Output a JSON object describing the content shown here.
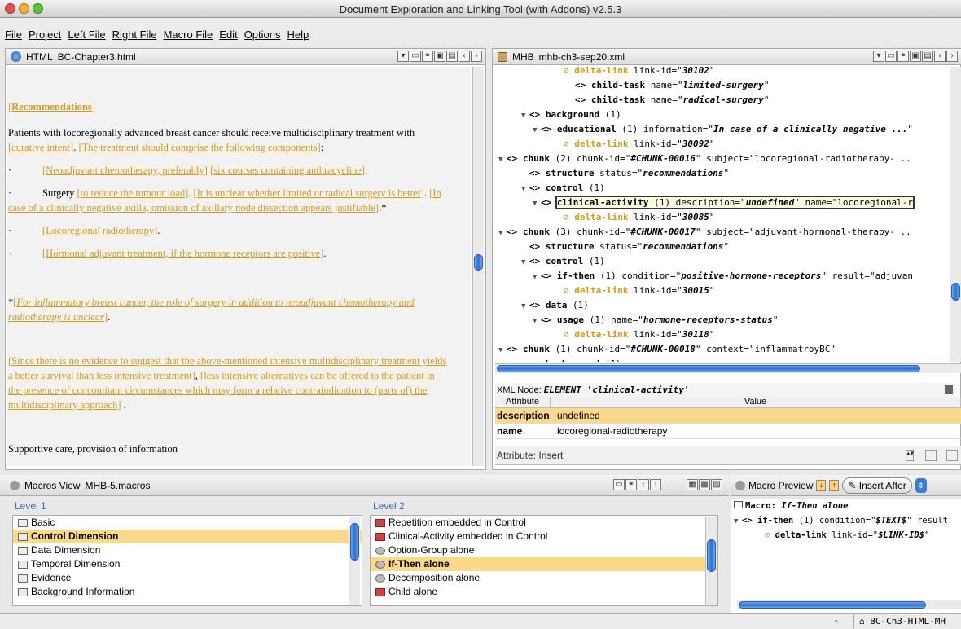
{
  "window": {
    "title": "Document Exploration and Linking Tool (with Addons) v2.5.3"
  },
  "menu": [
    "File",
    "Project",
    "Left File",
    "Right File",
    "Macro File",
    "Edit",
    "Options",
    "Help"
  ],
  "left_pane": {
    "type_label": "HTML",
    "file": "BC-Chapter3.html",
    "heading": "Recommendations",
    "intro": "Patients with locoregionally advanced breast cancer should receive multidisciplinary treatment with",
    "link_curative": "curative intent",
    "link_components": "The treatment should comprise the following components",
    "colon": ":",
    "bullet1_link1": "Neoadjuvant chemotherapy, preferably",
    "bullet1_link2": "six courses containing anthracycline",
    "bullet2_text": "Surgery",
    "bullet2_link1": "to reduce the tumour load",
    "bullet2_link2": "It is unclear whether limited or radical surgery is better",
    "bullet2_link3a": "In",
    "bullet2_link3b": "case of a clinically negative axilla, omission of axillary node dissection appears justifiable",
    "bullet2_star": ".*",
    "bullet3_link": "Locoregional radiotherapy",
    "bullet4_link": "Hormonal adjuvant treatment, if the hormone receptors are positive",
    "footnote_star": "*",
    "footnote_a": "For inflammatory breast cancer, the role of surgery in addition to neoadjuvant chemotherapy and",
    "footnote_b": "radiotherapy is unclear",
    "para_a": "Since there is no evidence to suggest that the above-mentioned intensive multidisciplinary treatment yields",
    "para_b": "a better survival than less intensive treatment",
    "para_c": "less intensive alternatives can be offered to the patient in",
    "para_d": "the presence of concomitant circumstances which may form a relative contraindication to (parts of) the",
    "para_e": "multidisciplinary approach",
    "para_end": " .",
    "last_line": "Supportive care, provision of information"
  },
  "right_pane": {
    "type_label": "MHB",
    "file": "mhb-ch3-sep20.xml",
    "rows": [
      {
        "indent": 7,
        "tri": "",
        "icon": "leaf",
        "tag": "delta-link",
        "rest": " link-id=\"",
        "val": "30102",
        "end": "\""
      },
      {
        "indent": 8,
        "tri": "",
        "icon": "ang",
        "tag": "child-task",
        "rest": " name=\"",
        "val": "limited-surgery",
        "end": "\""
      },
      {
        "indent": 8,
        "tri": "",
        "icon": "ang",
        "tag": "child-task",
        "rest": " name=\"",
        "val": "radical-surgery",
        "end": "\""
      },
      {
        "indent": 4,
        "tri": "▼",
        "icon": "ang",
        "tag": "background",
        "rest": " (1)",
        "val": "",
        "end": ""
      },
      {
        "indent": 5,
        "tri": "▼",
        "icon": "ang",
        "tag": "educational",
        "rest": " (1) information=\"",
        "val": "In case of a clinically negative ...",
        "end": "\""
      },
      {
        "indent": 7,
        "tri": "",
        "icon": "leaf",
        "tag": "delta-link",
        "rest": " link-id=\"",
        "val": "30092",
        "end": "\""
      },
      {
        "indent": 2,
        "tri": "▼",
        "icon": "ang",
        "tag": "chunk",
        "rest": " (2) chunk-id=\"",
        "val": "#CHUNK-00016",
        "end": "\" subject=\"locoregional-radiotherapy- .."
      },
      {
        "indent": 4,
        "tri": "",
        "icon": "ang",
        "tag": "structure",
        "rest": " status=\"",
        "val": "recommendations",
        "end": "\""
      },
      {
        "indent": 4,
        "tri": "▼",
        "icon": "ang",
        "tag": "control",
        "rest": " (1)",
        "val": "",
        "end": ""
      },
      {
        "indent": 5,
        "tri": "▼",
        "icon": "ang",
        "tag": "clinical-activity",
        "rest": " (1) description=\"",
        "val": "undefined",
        "end": "\" name=\"locoregional-r",
        "selected": true
      },
      {
        "indent": 7,
        "tri": "",
        "icon": "leaf",
        "tag": "delta-link",
        "rest": " link-id=\"",
        "val": "30085",
        "end": "\""
      },
      {
        "indent": 2,
        "tri": "▼",
        "icon": "ang",
        "tag": "chunk",
        "rest": " (3) chunk-id=\"",
        "val": "#CHUNK-00017",
        "end": "\" subject=\"adjuvant-hormonal-therapy- .."
      },
      {
        "indent": 4,
        "tri": "",
        "icon": "ang",
        "tag": "structure",
        "rest": " status=\"",
        "val": "recommendations",
        "end": "\""
      },
      {
        "indent": 4,
        "tri": "▼",
        "icon": "ang",
        "tag": "control",
        "rest": " (1)",
        "val": "",
        "end": ""
      },
      {
        "indent": 5,
        "tri": "▼",
        "icon": "ang",
        "tag": "if-then",
        "rest": " (1) condition=\"",
        "val": "positive-hormone-receptors",
        "end": "\" result=\"adjuvan"
      },
      {
        "indent": 7,
        "tri": "",
        "icon": "leaf",
        "tag": "delta-link",
        "rest": " link-id=\"",
        "val": "30015",
        "end": "\""
      },
      {
        "indent": 4,
        "tri": "▼",
        "icon": "ang",
        "tag": "data",
        "rest": " (1)",
        "val": "",
        "end": ""
      },
      {
        "indent": 5,
        "tri": "▼",
        "icon": "ang",
        "tag": "usage",
        "rest": " (1) name=\"",
        "val": "hormone-receptors-status",
        "end": "\""
      },
      {
        "indent": 7,
        "tri": "",
        "icon": "leaf",
        "tag": "delta-link",
        "rest": " link-id=\"",
        "val": "30118",
        "end": "\""
      },
      {
        "indent": 2,
        "tri": "▼",
        "icon": "ang",
        "tag": "chunk",
        "rest": " (1) chunk-id=\"",
        "val": "#CHUNK-00018",
        "end": "\" context=\"inflammatroyBC\""
      },
      {
        "indent": 4,
        "tri": "▼",
        "icon": "ang",
        "tag": "background",
        "rest": " (1)",
        "val": "",
        "end": ""
      }
    ],
    "xml_node_label": "XML Node:",
    "xml_node_value": "ELEMENT 'clinical-activity'",
    "attr_col1": "Attribute",
    "attr_col2": "Value",
    "attributes": [
      {
        "name": "description",
        "value": "undefined"
      },
      {
        "name": "name",
        "value": "locoregional-radiotherapy"
      }
    ],
    "attr_insert": "Attribute: Insert"
  },
  "macros": {
    "view_label": "Macros View",
    "file": "MHB-5.macros",
    "level1_title": "Level 1",
    "level2_title": "Level 2",
    "level1": [
      {
        "label": "Basic",
        "selected": false
      },
      {
        "label": "Control Dimension",
        "selected": true
      },
      {
        "label": "Data Dimension",
        "selected": false
      },
      {
        "label": "Temporal Dimension",
        "selected": false
      },
      {
        "label": "Evidence",
        "selected": false
      },
      {
        "label": "Background Information",
        "selected": false
      }
    ],
    "level2": [
      {
        "label": "Repetition embedded in Control",
        "icon": "red",
        "selected": false
      },
      {
        "label": "Clinical-Activity embedded in Control",
        "icon": "red",
        "selected": false
      },
      {
        "label": "Option-Group alone",
        "icon": "gear",
        "selected": false
      },
      {
        "label": "If-Then alone",
        "icon": "gear",
        "selected": true
      },
      {
        "label": "Decomposition alone",
        "icon": "gear",
        "selected": false
      },
      {
        "label": "Child alone",
        "icon": "red",
        "selected": false
      }
    ]
  },
  "preview": {
    "title": "Macro Preview",
    "insert_label": "Insert After",
    "macro_label": "Macro:",
    "macro_name": "If-Then alone",
    "line1_tag": "if-then",
    "line1_rest": " (1) condition=\"",
    "line1_val": "$TEXT$",
    "line1_end": "\" result",
    "line2_tag": "delta-link",
    "line2_rest": " link-id=\"",
    "line2_val": "$LINK-ID$",
    "line2_end": "\""
  },
  "status": {
    "dash": "-",
    "project": "BC-Ch3-HTML-MH"
  }
}
